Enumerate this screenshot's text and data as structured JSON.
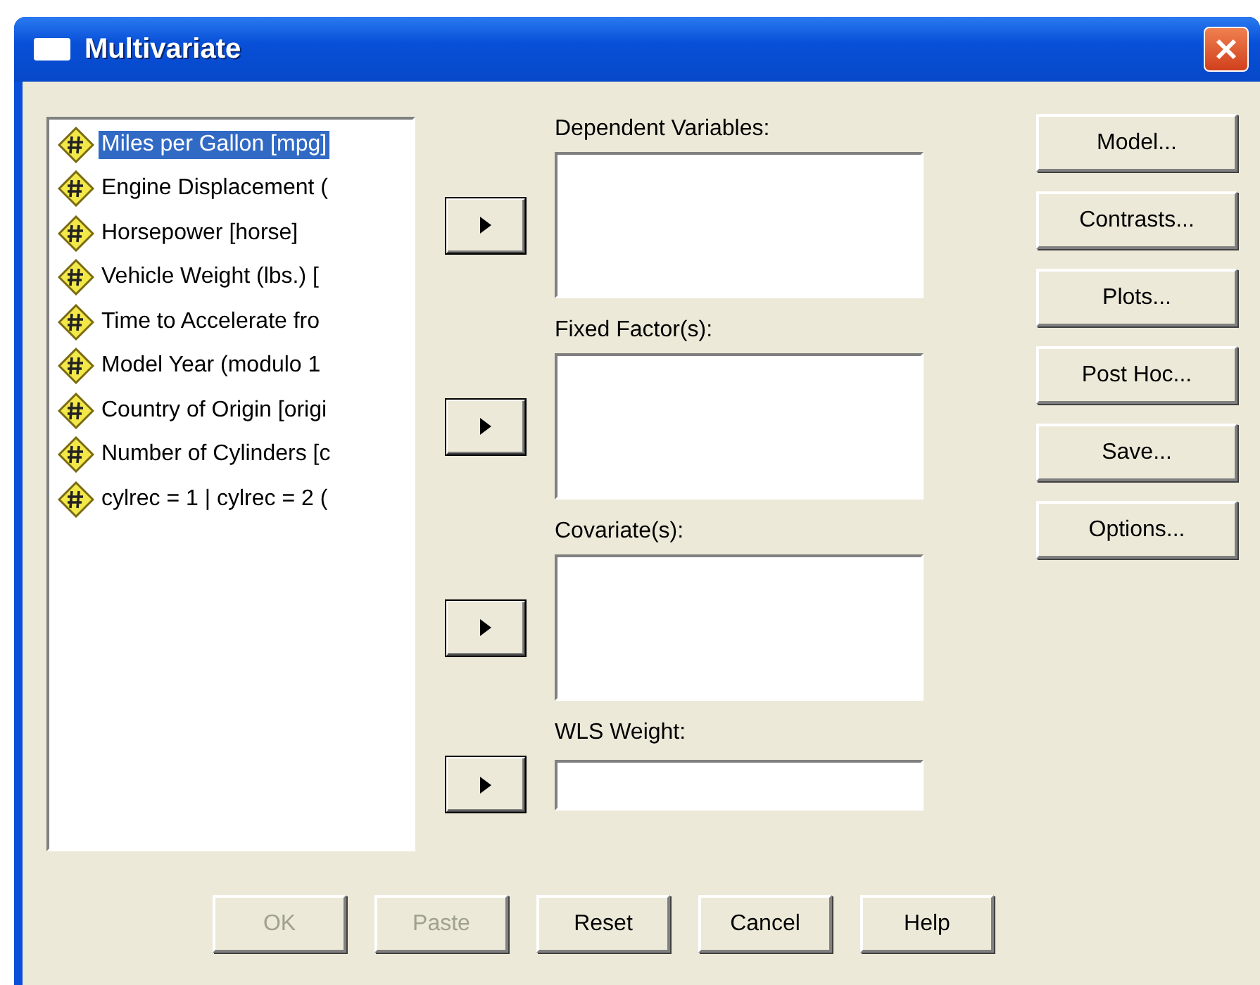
{
  "window": {
    "title": "Multivariate"
  },
  "variables": [
    {
      "label": "Miles per Gallon [mpg]",
      "selected": true
    },
    {
      "label": "Engine Displacement (",
      "selected": false
    },
    {
      "label": "Horsepower [horse]",
      "selected": false
    },
    {
      "label": "Vehicle Weight (lbs.) [",
      "selected": false
    },
    {
      "label": "Time to Accelerate fro",
      "selected": false
    },
    {
      "label": "Model Year (modulo 1",
      "selected": false
    },
    {
      "label": "Country of Origin [origi",
      "selected": false
    },
    {
      "label": "Number of Cylinders [c",
      "selected": false
    },
    {
      "label": "cylrec = 1 | cylrec = 2 (",
      "selected": false
    }
  ],
  "targets": [
    {
      "label": "Dependent Variables:",
      "kind": "list"
    },
    {
      "label": "Fixed Factor(s):",
      "kind": "list"
    },
    {
      "label": "Covariate(s):",
      "kind": "list"
    },
    {
      "label": "WLS Weight:",
      "kind": "field"
    }
  ],
  "side_buttons": [
    "Model...",
    "Contrasts...",
    "Plots...",
    "Post Hoc...",
    "Save...",
    "Options..."
  ],
  "bottom_buttons": [
    {
      "label": "OK",
      "disabled": true
    },
    {
      "label": "Paste",
      "disabled": true
    },
    {
      "label": "Reset",
      "disabled": false
    },
    {
      "label": "Cancel",
      "disabled": false
    },
    {
      "label": "Help",
      "disabled": false
    }
  ]
}
